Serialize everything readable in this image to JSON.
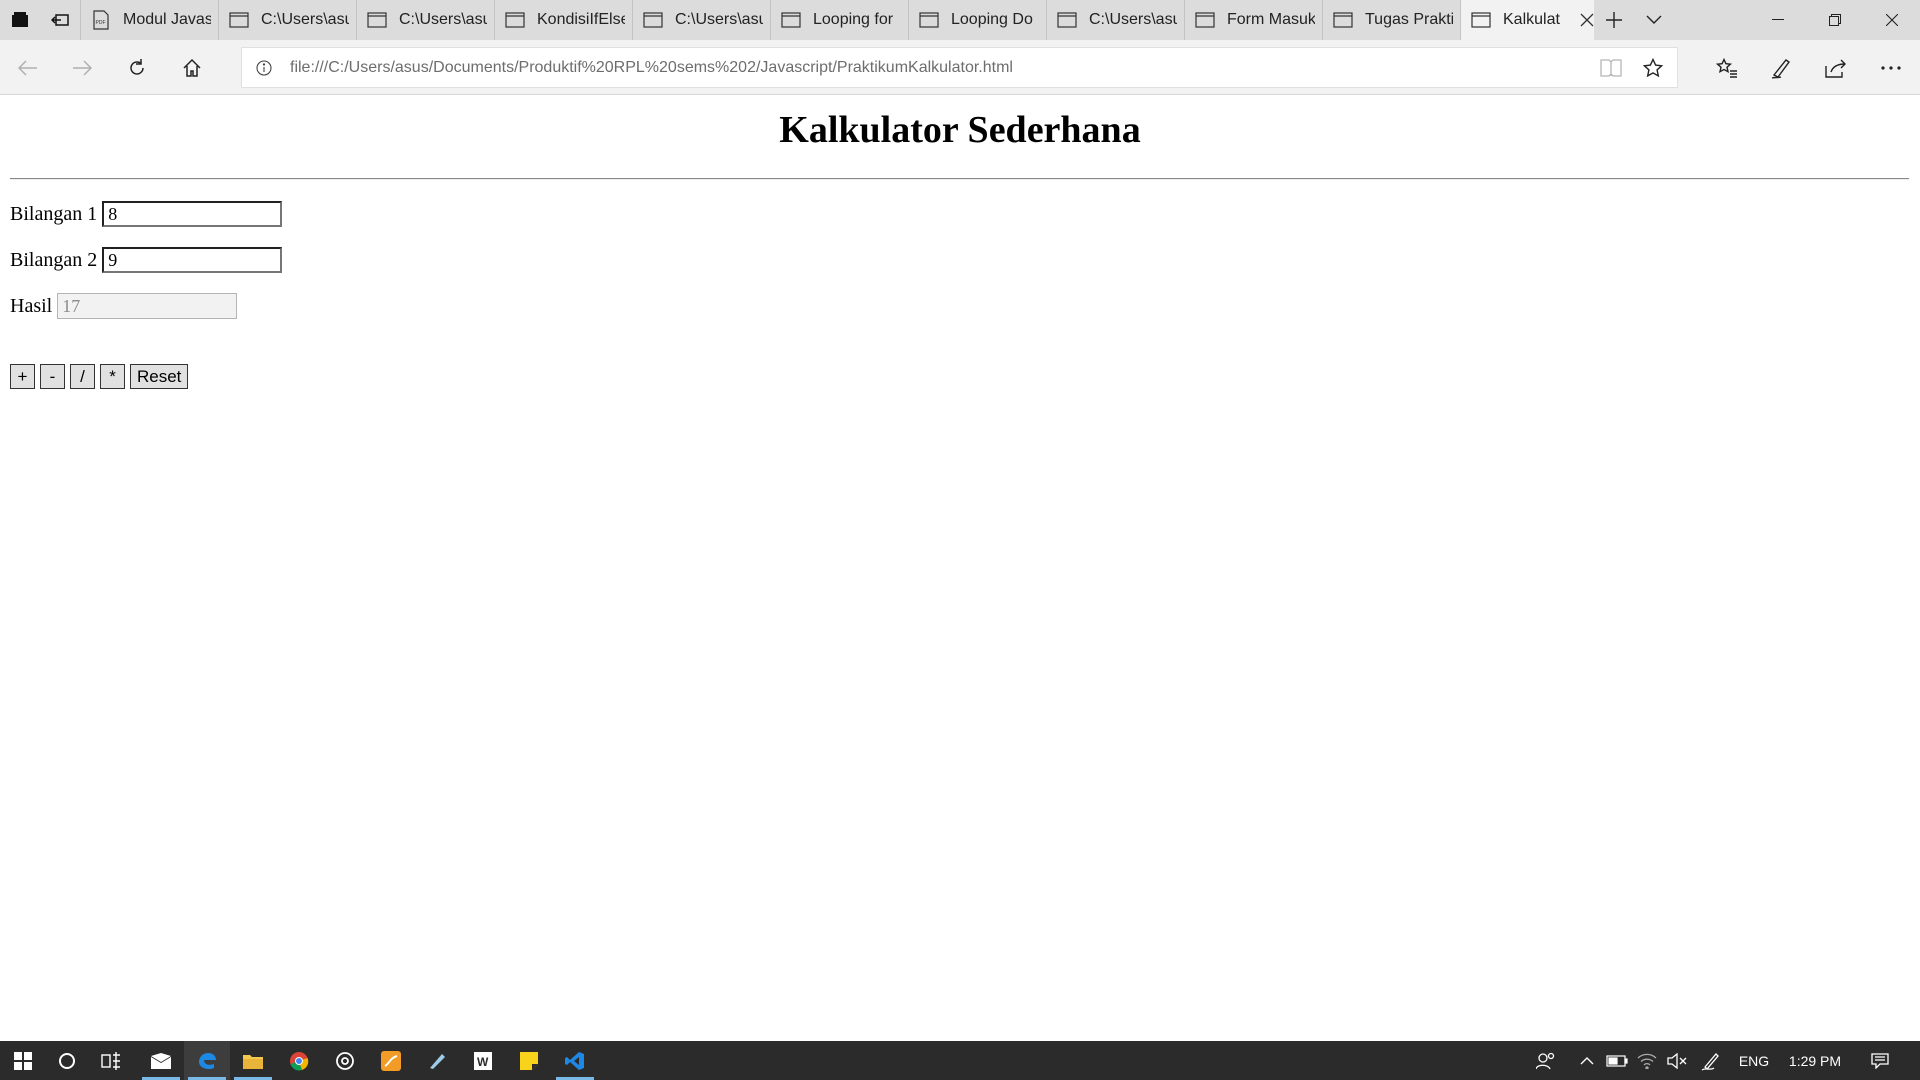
{
  "browser": {
    "tabs": [
      {
        "label": "Modul Javas",
        "icon": "pdf-icon"
      },
      {
        "label": "C:\\Users\\asu",
        "icon": "page-icon"
      },
      {
        "label": "C:\\Users\\asu",
        "icon": "page-icon"
      },
      {
        "label": "KondisiIfElse",
        "icon": "page-icon"
      },
      {
        "label": "C:\\Users\\asu",
        "icon": "page-icon"
      },
      {
        "label": "Looping for",
        "icon": "page-icon"
      },
      {
        "label": "Looping Do",
        "icon": "page-icon"
      },
      {
        "label": "C:\\Users\\asu",
        "icon": "page-icon"
      },
      {
        "label": "Form Masuk",
        "icon": "page-icon"
      },
      {
        "label": "Tugas Prakti",
        "icon": "page-icon"
      },
      {
        "label": "Kalkulat",
        "icon": "page-icon",
        "active": true
      }
    ],
    "address_url": "file:///C:/Users/asus/Documents/Produktif%20RPL%20sems%202/Javascript/PraktikumKalkulator.html"
  },
  "page": {
    "title": "Kalkulator Sederhana",
    "fields": {
      "bilangan1": {
        "label": "Bilangan 1",
        "value": "8"
      },
      "bilangan2": {
        "label": "Bilangan 2",
        "value": "9"
      },
      "hasil": {
        "label": "Hasil",
        "value": "17"
      }
    },
    "buttons": {
      "add": "+",
      "subtract": "-",
      "divide": "/",
      "multiply": "*",
      "reset": "Reset"
    }
  },
  "taskbar": {
    "language": "ENG",
    "time": "1:29 PM"
  }
}
